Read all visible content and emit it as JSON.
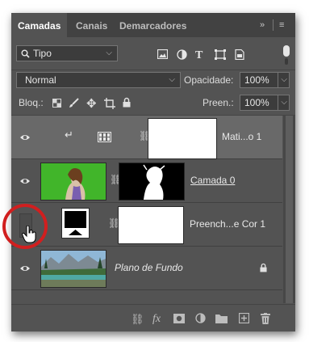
{
  "tabs": [
    {
      "label": "Camadas"
    },
    {
      "label": "Canais"
    },
    {
      "label": "Demarcadores"
    }
  ],
  "tab_menu": {
    "collapse": "»",
    "menu": "≡"
  },
  "filter": {
    "kind_label": "Tipo",
    "search_icon": "search-icon",
    "icons": [
      "image-filter-icon",
      "adjustment-filter-icon",
      "type-filter-icon",
      "shape-filter-icon",
      "smart-object-filter-icon"
    ],
    "type_glyph": "T"
  },
  "blend": {
    "mode": "Normal",
    "opacity_label": "Opacidade:",
    "opacity_value": "100%"
  },
  "lock": {
    "label": "Bloq.:",
    "fill_label": "Preen.:",
    "fill_value": "100%",
    "icons": [
      "lock-transparent-icon",
      "lock-paint-icon",
      "lock-move-icon",
      "lock-artboard-icon",
      "lock-all-icon"
    ]
  },
  "layers": [
    {
      "name": "Mati...o 1",
      "visible": true,
      "selected": true,
      "clipped": true,
      "type": "adjustment"
    },
    {
      "name": "Camada 0",
      "visible": true,
      "selected": false,
      "type": "pixel-with-mask"
    },
    {
      "name": "Preench...e Cor 1",
      "visible": false,
      "selected": false,
      "type": "solid-fill"
    },
    {
      "name": "Plano de Fundo",
      "visible": true,
      "selected": false,
      "locked": true,
      "type": "background"
    }
  ],
  "bottom_icons": [
    "link-icon",
    "fx-icon",
    "mask-icon",
    "adjustment-icon",
    "folder-icon",
    "new-layer-icon",
    "trash-icon"
  ],
  "fx_label": "fx",
  "colors": {
    "panel": "#535353",
    "selected_layer": "#696969",
    "highlight_circle": "#d11f1f"
  }
}
